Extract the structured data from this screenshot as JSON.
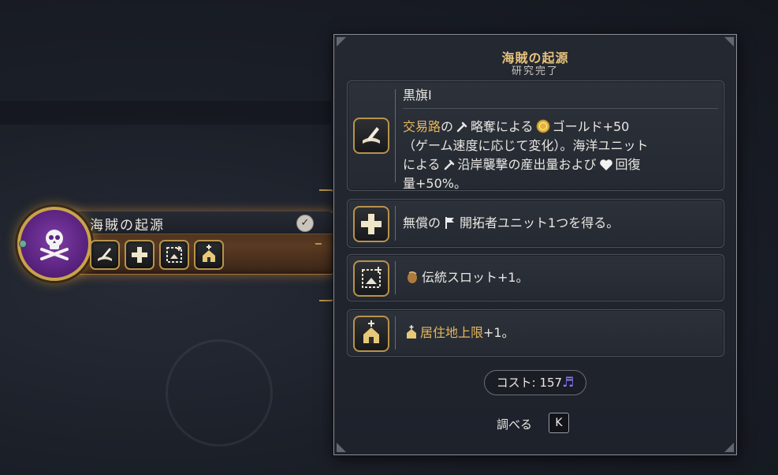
{
  "node": {
    "title": "海賊の起源",
    "completed_icon": "checkmark-icon",
    "medallion_icon": "skull-crossbones-icon",
    "unlock_icons": [
      "scroll-quill-icon",
      "plus-icon",
      "slot-frame-icon",
      "house-icon"
    ]
  },
  "panel": {
    "title": "海賊の起源",
    "subtitle": "研究完了",
    "rows": [
      {
        "icon": "scroll-quill-icon",
        "heading": "黒旗I",
        "text": {
          "a": "交易路",
          "b": "の",
          "c": "略奪による",
          "d": "ゴールド+50",
          "e": "（ゲーム速度に応じて変化）。海洋ユニット",
          "f": "による",
          "g": "沿岸襲撃の産出量および",
          "h": "回復",
          "i": "量+50%。"
        }
      },
      {
        "icon": "plus-icon",
        "text": {
          "a": "無償の",
          "b": "開拓者ユニット1つを得る。"
        }
      },
      {
        "icon": "slot-frame-icon",
        "text": {
          "a": "伝統スロット+1。"
        }
      },
      {
        "icon": "house-icon",
        "text": {
          "a": "居住地上限",
          "b": "+1。"
        }
      }
    ],
    "cost": "コスト: 157",
    "cost_icon": "culture-note-icon",
    "inspect_label": "調べる",
    "inspect_key": "K"
  },
  "colors": {
    "accent_gold": "#e7b75a",
    "title_gold": "#e6c37e",
    "medallion_purple": "#5b2380",
    "culture": "#8a7bff"
  }
}
